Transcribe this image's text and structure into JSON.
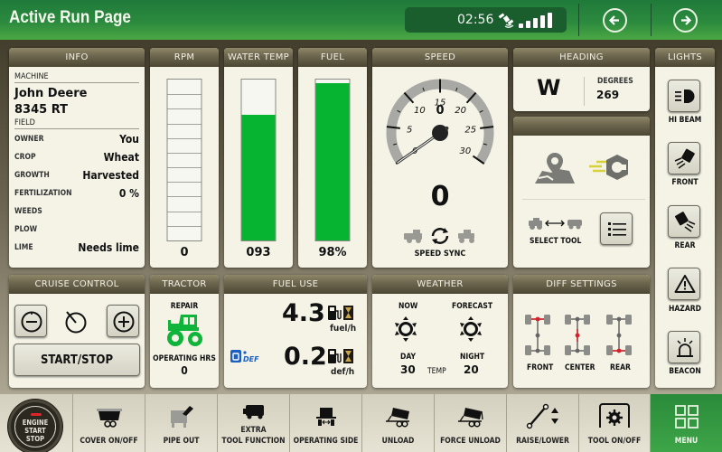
{
  "header": {
    "title": "Active Run Page",
    "clock": "02:56",
    "gps_icon": "satellite-icon",
    "signal_bars": 5,
    "signal_strength_filled": 5,
    "back_icon": "arrow-left-icon",
    "forward_icon": "arrow-right-icon"
  },
  "info": {
    "title": "INFO",
    "machine_label": "MACHINE",
    "machine_make": "John Deere",
    "machine_model": "8345 RT",
    "field_label": "FIELD",
    "rows": [
      {
        "key": "OWNER",
        "value": "You"
      },
      {
        "key": "CROP",
        "value": "Wheat"
      },
      {
        "key": "GROWTH",
        "value": "Harvested"
      },
      {
        "key": "FERTILIZATION",
        "value": "0 %"
      },
      {
        "key": "WEEDS",
        "value": ""
      },
      {
        "key": "PLOW",
        "value": ""
      },
      {
        "key": "LIME",
        "value": "Needs lime"
      }
    ]
  },
  "rpm": {
    "title": "RPM",
    "value": "0",
    "fill_fraction": 0,
    "segments": 11
  },
  "water_temp": {
    "title": "WATER TEMP",
    "value": "093",
    "fill_fraction": 0.78
  },
  "fuel": {
    "title": "FUEL",
    "value": "98%",
    "fill_fraction": 0.98
  },
  "speed": {
    "title": "SPEED",
    "gauge_min": 0,
    "gauge_max": 30,
    "tick_labels": [
      "0",
      "5",
      "10",
      "15",
      "20",
      "25",
      "30"
    ],
    "inner_value": "0",
    "value": "0",
    "sync_label": "SPEED SYNC"
  },
  "heading": {
    "title": "HEADING",
    "direction": "W",
    "degrees_label": "DEGREES",
    "degrees": "269"
  },
  "tool_panel": {
    "title": "",
    "select_tool_label": "SELECT TOOL"
  },
  "lights": {
    "title": "LIGHTS",
    "items": [
      {
        "label": "HI BEAM",
        "icon": "high-beam-icon"
      },
      {
        "label": "FRONT",
        "icon": "front-light-icon"
      },
      {
        "label": "REAR",
        "icon": "rear-light-icon"
      },
      {
        "label": "HAZARD",
        "icon": "hazard-icon"
      },
      {
        "label": "BEACON",
        "icon": "beacon-icon"
      }
    ]
  },
  "cruise": {
    "title": "CRUISE CONTROL",
    "start_stop": "START/STOP"
  },
  "tractor": {
    "title": "TRACTOR",
    "repair_label": "REPAIR",
    "hrs_label": "OPERATING HRS",
    "hrs": "0",
    "status_color": "#0fb43a"
  },
  "fuel_use": {
    "title": "FUEL USE",
    "fuel_rate": "4.3",
    "fuel_unit": "fuel/h",
    "def_rate": "0.2",
    "def_unit": "def/h",
    "def_badge": "DEF"
  },
  "weather": {
    "title": "WEATHER",
    "now_label": "NOW",
    "forecast_label": "FORECAST",
    "day_label": "DAY",
    "night_label": "NIGHT",
    "temp_label": "TEMP",
    "day_temp": "30",
    "night_temp": "20"
  },
  "diff": {
    "title": "DIFF SETTINGS",
    "items": [
      {
        "label": "FRONT",
        "active": "front"
      },
      {
        "label": "CENTER",
        "active": "center"
      },
      {
        "label": "REAR",
        "active": "rear"
      }
    ],
    "active_color": "#d8202a"
  },
  "bottom": {
    "engine": [
      "ENGINE",
      "START",
      "STOP"
    ],
    "buttons": [
      {
        "label": "COVER ON/OFF",
        "icon": "cover-icon"
      },
      {
        "label": "PIPE OUT",
        "icon": "pipe-icon"
      },
      {
        "label": "EXTRA\nTOOL FUNCTION",
        "icon": "tool-function-icon"
      },
      {
        "label": "OPERATING SIDE",
        "icon": "operating-side-icon"
      },
      {
        "label": "UNLOAD",
        "icon": "unload-icon"
      },
      {
        "label": "FORCE UNLOAD",
        "icon": "force-unload-icon"
      },
      {
        "label": "RAISE/LOWER",
        "icon": "raise-lower-icon"
      },
      {
        "label": "TOOL ON/OFF",
        "icon": "tool-onoff-icon"
      },
      {
        "label": "MENU",
        "icon": "menu-grid-icon"
      }
    ]
  }
}
